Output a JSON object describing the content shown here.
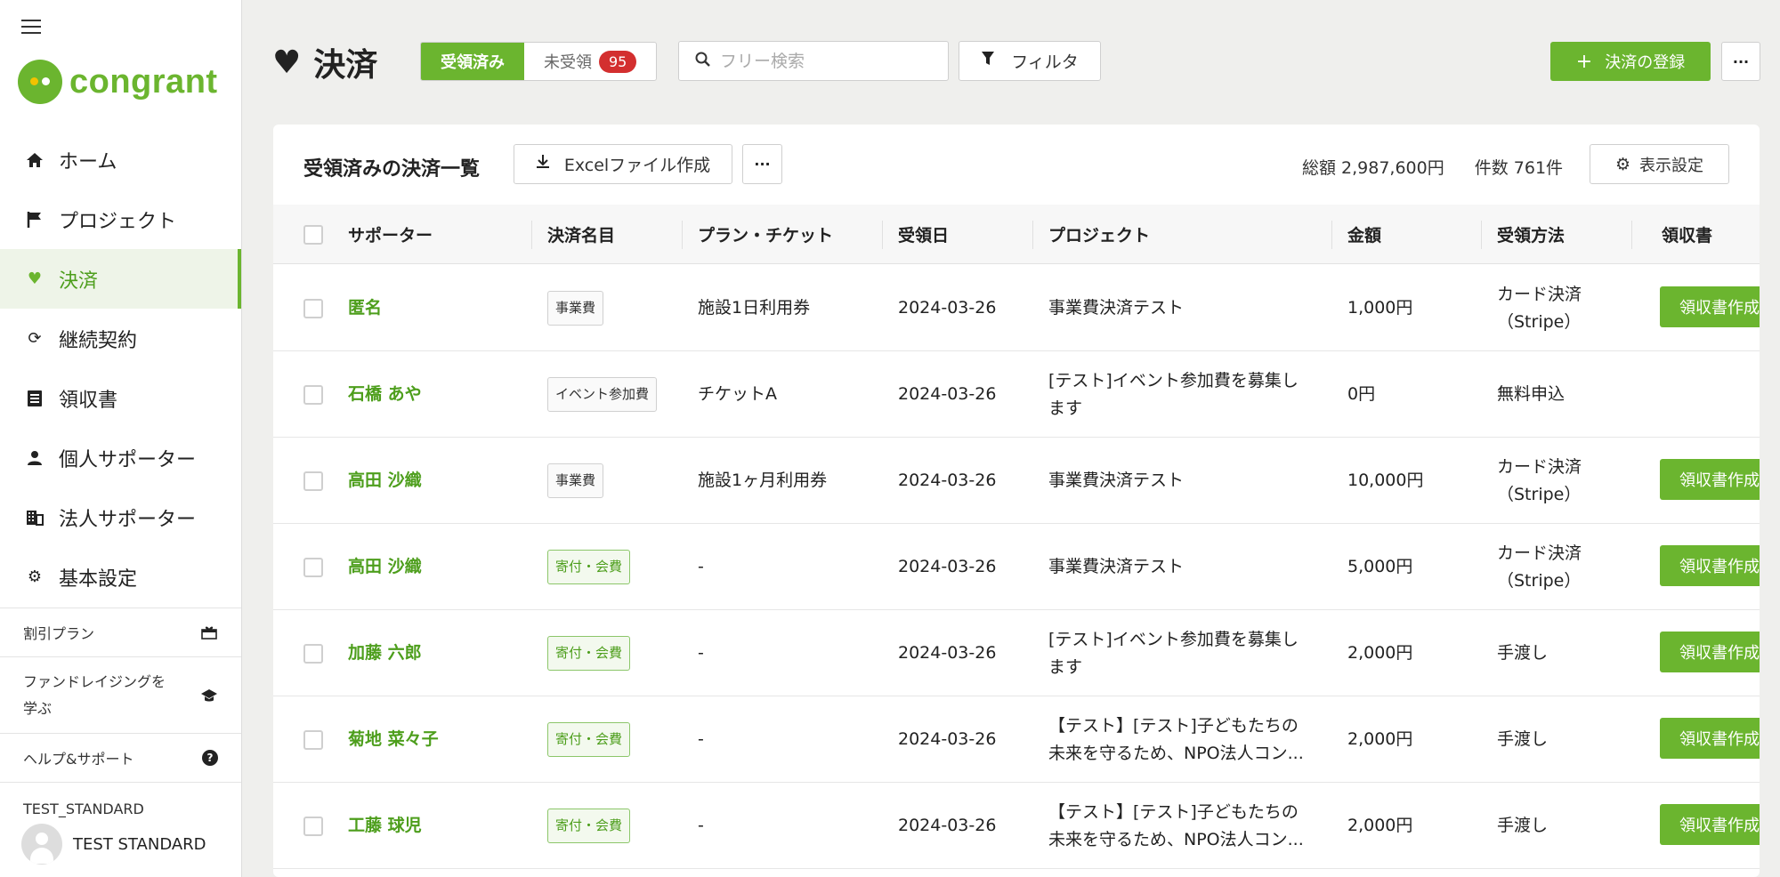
{
  "sidebar": {
    "logo_text": "congrant",
    "nav": [
      {
        "label": "ホーム",
        "icon": "home-icon"
      },
      {
        "label": "プロジェクト",
        "icon": "flag-icon"
      },
      {
        "label": "決済",
        "icon": "heart-icon"
      },
      {
        "label": "継続契約",
        "icon": "refresh-icon"
      },
      {
        "label": "領収書",
        "icon": "receipt-icon"
      },
      {
        "label": "個人サポーター",
        "icon": "person-icon"
      },
      {
        "label": "法人サポーター",
        "icon": "building-icon"
      },
      {
        "label": "基本設定",
        "icon": "gear-icon"
      }
    ],
    "links": [
      {
        "label": "割引プラン",
        "icon": "gift-icon"
      },
      {
        "label_1": "ファンドレイジングを",
        "label_2": "学ぶ",
        "icon": "graduation-cap-icon"
      },
      {
        "label": "ヘルプ&サポート",
        "icon": "help-icon"
      }
    ],
    "org_name": "TEST_STANDARD",
    "user_name": "TEST STANDARD"
  },
  "header": {
    "title": "決済",
    "tab_received": "受領済み",
    "tab_unreceived": "未受領",
    "unreceived_count": "95",
    "search_placeholder": "フリー検索",
    "filter_label": "フィルタ",
    "register_label": "決済の登録",
    "more_label": "···"
  },
  "card": {
    "title": "受領済みの決済一覧",
    "excel_label": "Excelファイル作成",
    "more_label": "···",
    "total_amount": "総額 2,987,600円",
    "total_count": "件数 761件",
    "settings_label": "表示設定"
  },
  "table": {
    "columns": [
      "サポーター",
      "決済名目",
      "プラン・チケット",
      "受領日",
      "プロジェクト",
      "金額",
      "受領方法",
      "領収書"
    ],
    "receipt_button_label": "領収書作成",
    "rows": [
      {
        "supporter": "匿名",
        "category": "事業費",
        "category_style": "gray",
        "plan": "施設1日利用券",
        "date": "2024-03-26",
        "project_1": "事業費決済テスト",
        "project_2": "",
        "amount": "1,000円",
        "method_1": "カード決済",
        "method_2": "（Stripe）",
        "receipt": true
      },
      {
        "supporter": "石橋 あや",
        "category": "イベント参加費",
        "category_style": "gray",
        "plan": "チケットA",
        "date": "2024-03-26",
        "project_1": "[テスト]イベント参加費を募集し",
        "project_2": "ます",
        "amount": "0円",
        "method_1": "無料申込",
        "method_2": "",
        "receipt": false
      },
      {
        "supporter": "高田 沙織",
        "category": "事業費",
        "category_style": "gray",
        "plan": "施設1ヶ月利用券",
        "date": "2024-03-26",
        "project_1": "事業費決済テスト",
        "project_2": "",
        "amount": "10,000円",
        "method_1": "カード決済",
        "method_2": "（Stripe）",
        "receipt": true
      },
      {
        "supporter": "高田 沙織",
        "category": "寄付・会費",
        "category_style": "green",
        "plan": "-",
        "date": "2024-03-26",
        "project_1": "事業費決済テスト",
        "project_2": "",
        "amount": "5,000円",
        "method_1": "カード決済",
        "method_2": "（Stripe）",
        "receipt": true
      },
      {
        "supporter": "加藤 六郎",
        "category": "寄付・会費",
        "category_style": "green",
        "plan": "-",
        "date": "2024-03-26",
        "project_1": "[テスト]イベント参加費を募集し",
        "project_2": "ます",
        "amount": "2,000円",
        "method_1": "手渡し",
        "method_2": "",
        "receipt": true
      },
      {
        "supporter": "菊地 菜々子",
        "category": "寄付・会費",
        "category_style": "green",
        "plan": "-",
        "date": "2024-03-26",
        "project_1": "【テスト】[テスト]子どもたちの",
        "project_2": "未来を守るため、NPO法人コン...",
        "amount": "2,000円",
        "method_1": "手渡し",
        "method_2": "",
        "receipt": true
      },
      {
        "supporter": "工藤 球児",
        "category": "寄付・会費",
        "category_style": "green",
        "plan": "-",
        "date": "2024-03-26",
        "project_1": "【テスト】[テスト]子どもたちの",
        "project_2": "未来を守るため、NPO法人コン...",
        "amount": "2,000円",
        "method_1": "手渡し",
        "method_2": "",
        "receipt": true
      }
    ]
  },
  "colors": {
    "accent": "#6bb52f",
    "badge": "#d32f2f"
  }
}
